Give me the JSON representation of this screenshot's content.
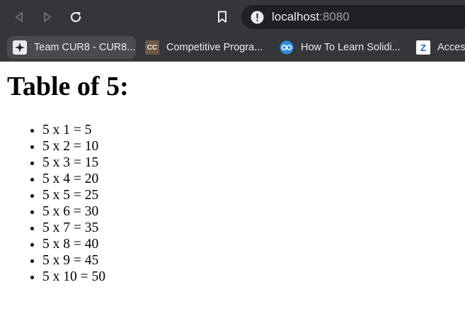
{
  "browser": {
    "url_host": "localhost",
    "url_port": ":8080",
    "bookmarks": [
      {
        "label": "Team CUR8 - CUR8...",
        "icon": "sparkle-icon"
      },
      {
        "label": "Competitive Progra...",
        "icon": "cc-icon",
        "icon_text": "CC"
      },
      {
        "label": "How To Learn Solidi...",
        "icon": "blue-glasses-icon"
      },
      {
        "label": "Access",
        "icon": "z-icon",
        "icon_text": "Z"
      }
    ]
  },
  "page": {
    "heading": "Table of 5:",
    "items": [
      "5 x 1 = 5",
      "5 x 2 = 10",
      "5 x 3 = 15",
      "5 x 4 = 20",
      "5 x 5 = 25",
      "5 x 6 = 30",
      "5 x 7 = 35",
      "5 x 8 = 40",
      "5 x 9 = 45",
      "5 x 10 = 50"
    ]
  }
}
